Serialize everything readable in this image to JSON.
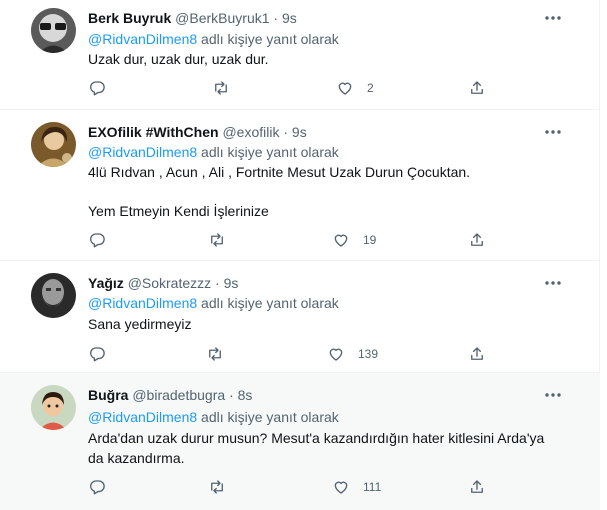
{
  "reply_prefix": "adlı kişiye yanıt olarak",
  "tweets": [
    {
      "name": "Berk Buyruk",
      "handle": "@BerkBuyruk1",
      "separator": "·",
      "time": "9s",
      "mention": "@RidvanDilmen8",
      "text": [
        "Uzak dur, uzak dur, uzak dur."
      ],
      "reply_count": "",
      "retweet_count": "",
      "like_count": "2"
    },
    {
      "name": "EXOfilik #WithChen",
      "handle": "@exofilik",
      "separator": "·",
      "time": "9s",
      "mention": "@RidvanDilmen8",
      "text": [
        "4lü Rıdvan , Acun , Ali , Fortnite Mesut Uzak Durun Çocuktan.",
        "",
        "Yem Etmeyin Kendi İşlerinize"
      ],
      "reply_count": "",
      "retweet_count": "",
      "like_count": "19"
    },
    {
      "name": "Yağız",
      "handle": "@Sokratezzz",
      "separator": "·",
      "time": "9s",
      "mention": "@RidvanDilmen8",
      "text": [
        "Sana yedirmeyiz"
      ],
      "reply_count": "",
      "retweet_count": "",
      "like_count": "139"
    },
    {
      "name": "Buğra",
      "handle": "@biradetbugra",
      "separator": "·",
      "time": "8s",
      "mention": "@RidvanDilmen8",
      "text": [
        "Arda'dan uzak durur musun? Mesut'a kazandırdığın hater kitlesini Arda'ya",
        "da kazandırma."
      ],
      "reply_count": "",
      "retweet_count": "",
      "like_count": "111"
    }
  ],
  "icons": {
    "more": "more-horizontal-icon",
    "reply": "reply-bubble-icon",
    "retweet": "retweet-icon",
    "like": "heart-icon",
    "share": "share-upload-icon"
  },
  "colors": {
    "mention": "#1d9bf0",
    "secondary_text": "#536471",
    "highlight_background": "#f7f9f9"
  }
}
